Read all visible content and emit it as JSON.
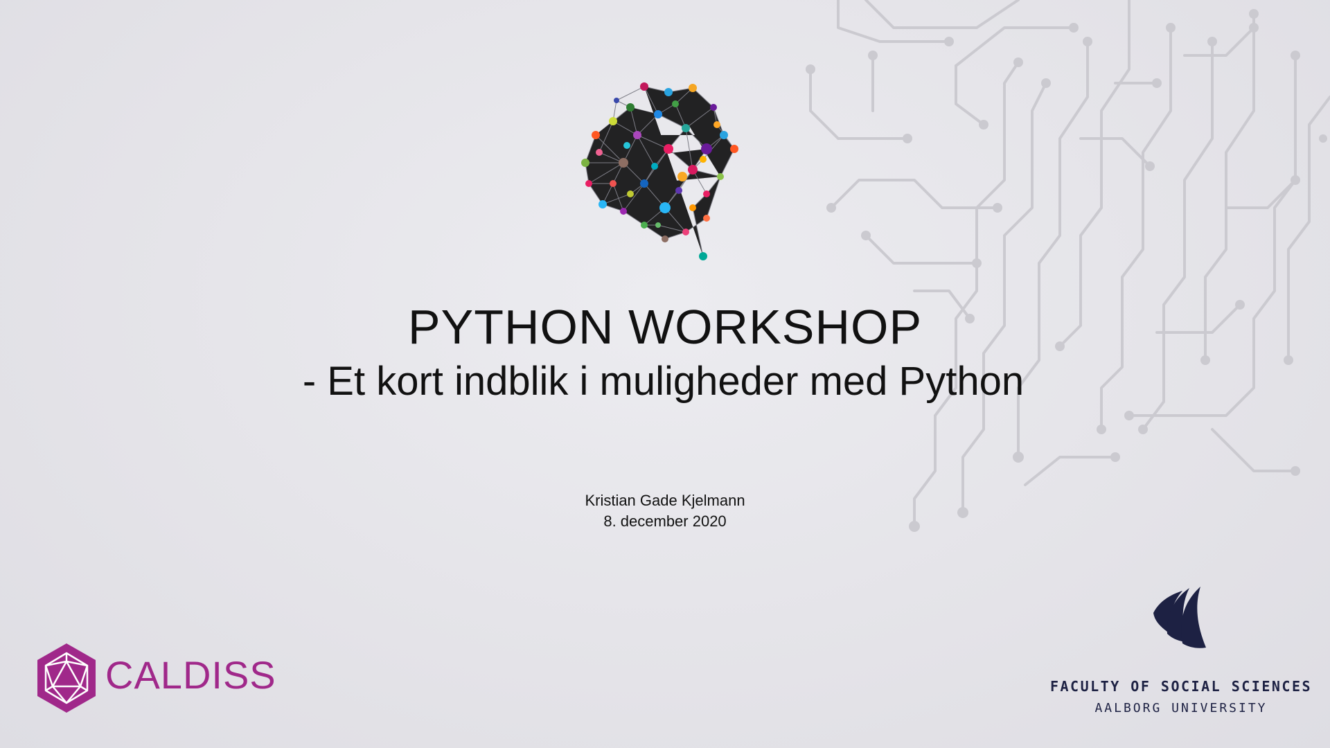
{
  "slide": {
    "title": "PYTHON WORKSHOP",
    "subtitle": "- Et kort indblik i muligheder med Python",
    "author": "Kristian Gade Kjelmann",
    "date": "8. december 2020"
  },
  "logos": {
    "caldiss": {
      "text": "CALDISS",
      "icon": "icosahedron-hexagon-icon",
      "color": "#a0288a"
    },
    "aau": {
      "line1": "FACULTY OF SOCIAL SCIENCES",
      "line2": "AALBORG UNIVERSITY",
      "icon": "aau-wave-logo-icon",
      "color": "#1d2143"
    }
  },
  "decor": {
    "brain": "network-brain-icon",
    "background": "circuit-board-pattern"
  }
}
